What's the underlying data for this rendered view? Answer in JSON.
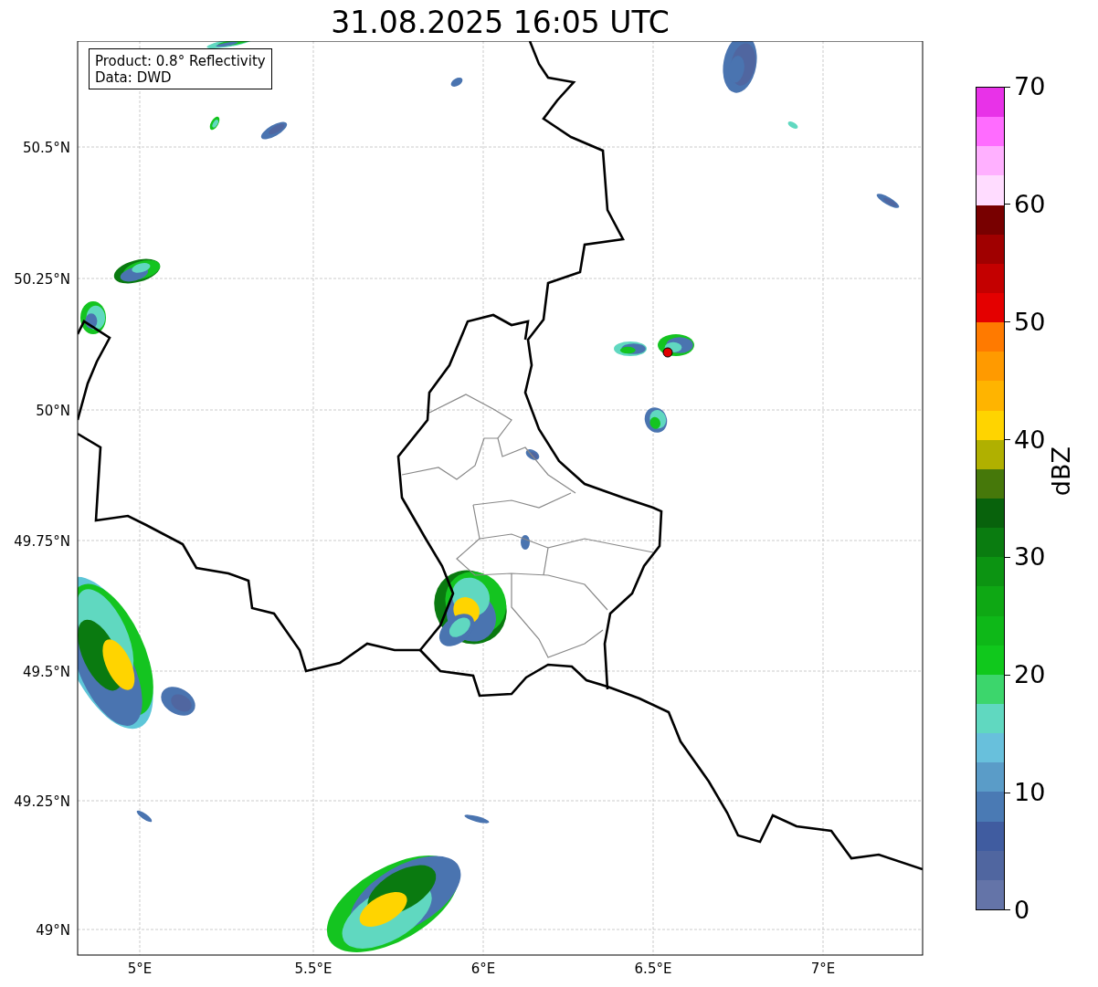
{
  "title": "31.08.2025 16:05 UTC",
  "info_box": [
    "Product: 0.8° Reflectivity",
    "Data: DWD"
  ],
  "x_ticks": [
    "5°E",
    "5.5°E",
    "6°E",
    "6.5°E",
    "7°E"
  ],
  "y_ticks": [
    "50.5°N",
    "50.25°N",
    "50°N",
    "49.75°N",
    "49.5°N",
    "49.25°N",
    "49°N"
  ],
  "colorbar": {
    "label": "dBZ",
    "ticks": [
      "70",
      "60",
      "50",
      "40",
      "30",
      "20",
      "10",
      "0"
    ],
    "bins": [
      {
        "color": "#e832e8"
      },
      {
        "color": "#ff6cff"
      },
      {
        "color": "#ffb0ff"
      },
      {
        "color": "#ffdcff"
      },
      {
        "color": "#780000"
      },
      {
        "color": "#a00000"
      },
      {
        "color": "#c40000"
      },
      {
        "color": "#e40000"
      },
      {
        "color": "#ff7a00"
      },
      {
        "color": "#ff9a00"
      },
      {
        "color": "#ffb400"
      },
      {
        "color": "#ffd400"
      },
      {
        "color": "#b0b000"
      },
      {
        "color": "#46780a"
      },
      {
        "color": "#08620c"
      },
      {
        "color": "#0a7c10"
      },
      {
        "color": "#0c9412"
      },
      {
        "color": "#0ea814"
      },
      {
        "color": "#0eb818"
      },
      {
        "color": "#10c81c"
      },
      {
        "color": "#3cd66c"
      },
      {
        "color": "#60d8c0"
      },
      {
        "color": "#68c0dc"
      },
      {
        "color": "#5a9cc8"
      },
      {
        "color": "#4a7ab4"
      },
      {
        "color": "#405ca0"
      },
      {
        "color": "#5066a0"
      },
      {
        "color": "#6474a8"
      }
    ]
  }
}
